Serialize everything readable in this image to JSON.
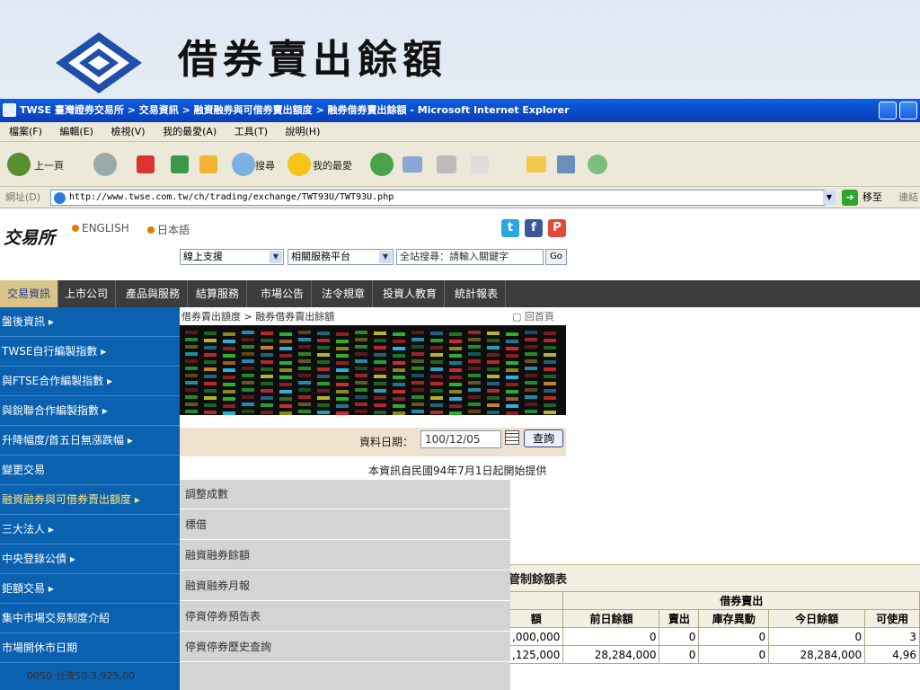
{
  "slide": {
    "title": "借券賣出餘額"
  },
  "window": {
    "title": "TWSE 臺灣證券交易所 > 交易資訊 > 融資融券與可借券賣出額度 > 融券借券賣出餘額 - Microsoft Internet Explorer",
    "menu": [
      "檔案(F)",
      "編輯(E)",
      "檢視(V)",
      "我的最愛(A)",
      "工具(T)",
      "說明(H)"
    ],
    "toolbar": {
      "back": "上一頁",
      "search": "搜尋",
      "favorites": "我的最愛"
    },
    "address_label": "網址(D)",
    "url": "http://www.twse.com.tw/ch/trading/exchange/TWT93U/TWT93U.php",
    "go_label": "移至",
    "links_label": "連結"
  },
  "site": {
    "brand": "交易所",
    "lang_en": "ENGLISH",
    "lang_jp": "日本語",
    "select1": "線上支援",
    "select2": "相關服務平台",
    "search_placeholder": "全站搜尋：請輸入關鍵字",
    "search_go": "Go"
  },
  "nav": [
    "交易資訊",
    "上市公司",
    "產品與服務",
    "結算服務",
    "市場公告",
    "法令規章",
    "投資人教育",
    "統計報表"
  ],
  "sidebar": [
    "盤後資訊 ▸",
    "TWSE自行編製指數 ▸",
    "與FTSE合作編製指數 ▸",
    "與銳聯合作編製指數 ▸",
    "升降幅度/首五日無漲跌幅 ▸",
    "變更交易",
    "融資融券與可借券賣出額度 ▸",
    "三大法人 ▸",
    "中央登錄公債 ▸",
    "鉅額交易 ▸",
    "集中市場交易制度介紹",
    "市場開休市日期"
  ],
  "breadcrumb": "借券賣出額度 > 融券借券賣出餘額",
  "home_link": "回首頁",
  "date_label": "資料日期：",
  "date_value": "100/12/05",
  "query_button": "查詢",
  "notice": "本資訊自民國94年7月1日起開始提供",
  "submenu": [
    "調整成數",
    "標借",
    "融資融券餘額",
    "融資融券月報",
    "停資停券預告表",
    "停資停券歷史查詢"
  ],
  "table": {
    "title": "管制餘額表",
    "group_header": "借券賣出",
    "headers": [
      "額",
      "前日餘額",
      "賣出",
      "庫存異動",
      "今日餘額",
      "可使用"
    ],
    "rows": [
      [
        ",000,000",
        "0",
        "0",
        "0",
        "0",
        "3"
      ],
      [
        ",125,000",
        "28,284,000",
        "0",
        "0",
        "28,284,000",
        "4,96"
      ]
    ],
    "partial_row": "0050 台灣50   3,925,00"
  }
}
